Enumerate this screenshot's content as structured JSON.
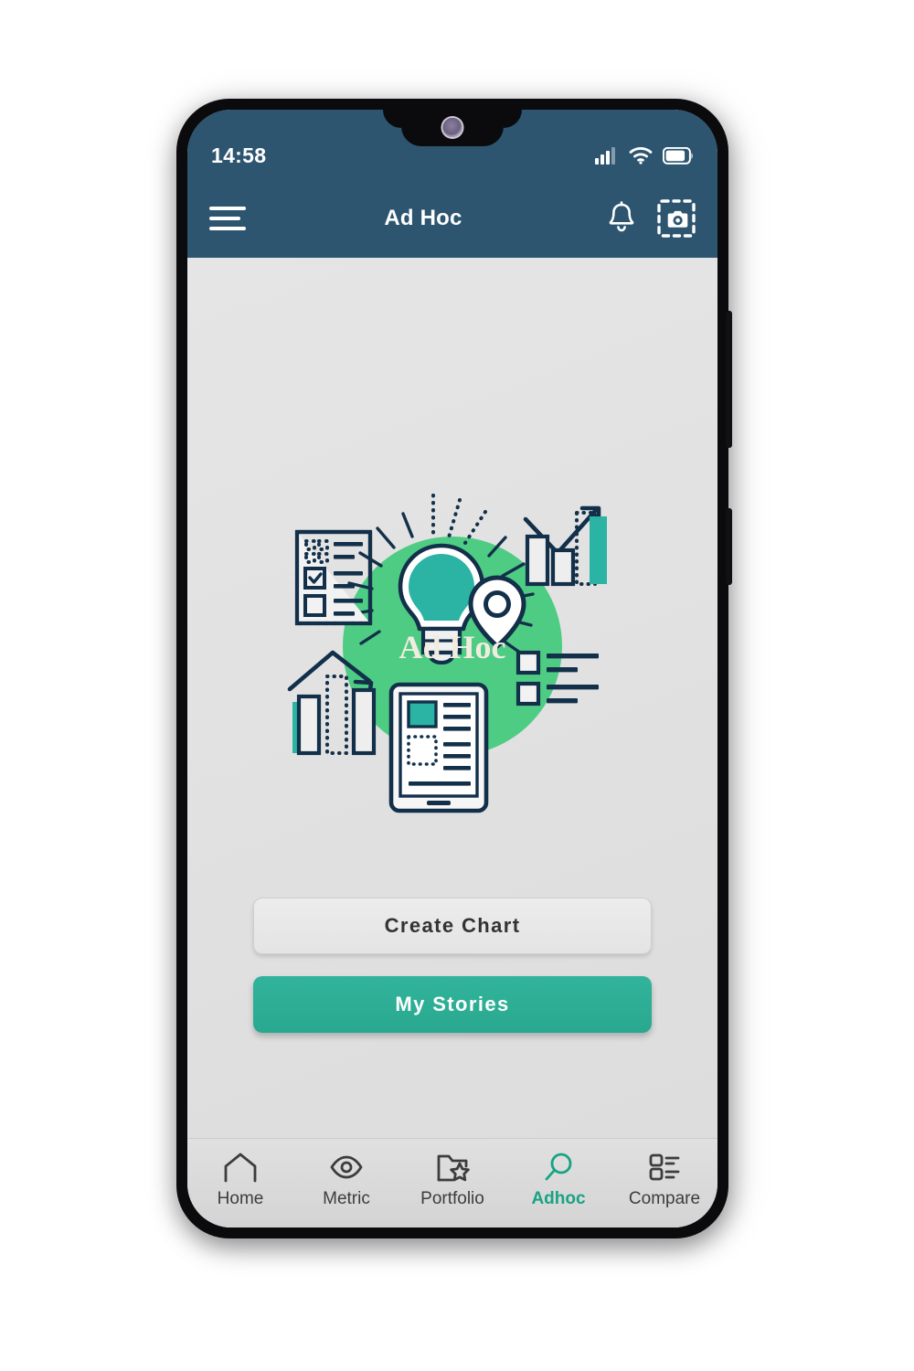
{
  "status_bar": {
    "time": "14:58",
    "icons": [
      "signal-icon",
      "wifi-icon",
      "battery-icon"
    ],
    "battery_level": 70
  },
  "app_bar": {
    "menu_icon": "hamburger-menu-icon",
    "title": "Ad Hoc",
    "actions": [
      {
        "icon": "bell-notification-icon",
        "name": "notifications-button"
      },
      {
        "icon": "screenshot-camera-icon",
        "name": "screenshot-button"
      }
    ]
  },
  "hero": {
    "center_label": "Ad Hoc",
    "circle_color": "#4fcc84",
    "accent_color": "#2bb3a3",
    "outline_color": "#13304a",
    "elements": [
      "lightbulb-icon",
      "checklist-document-icon",
      "growth-bar-chart-icon",
      "location-pin-icon",
      "bullet-list-icon",
      "peak-bar-chart-icon",
      "tablet-report-icon"
    ]
  },
  "actions": {
    "create_chart_label": "Create Chart",
    "my_stories_label": "My Stories"
  },
  "bottom_nav": {
    "active_index": 3,
    "active_color": "#17a383",
    "inactive_color": "#3d3d3d",
    "items": [
      {
        "label": "Home",
        "icon": "home-icon"
      },
      {
        "label": "Metric",
        "icon": "eye-icon"
      },
      {
        "label": "Portfolio",
        "icon": "folder-star-icon"
      },
      {
        "label": "Adhoc",
        "icon": "magnifier-icon"
      },
      {
        "label": "Compare",
        "icon": "compare-list-icon"
      }
    ]
  }
}
